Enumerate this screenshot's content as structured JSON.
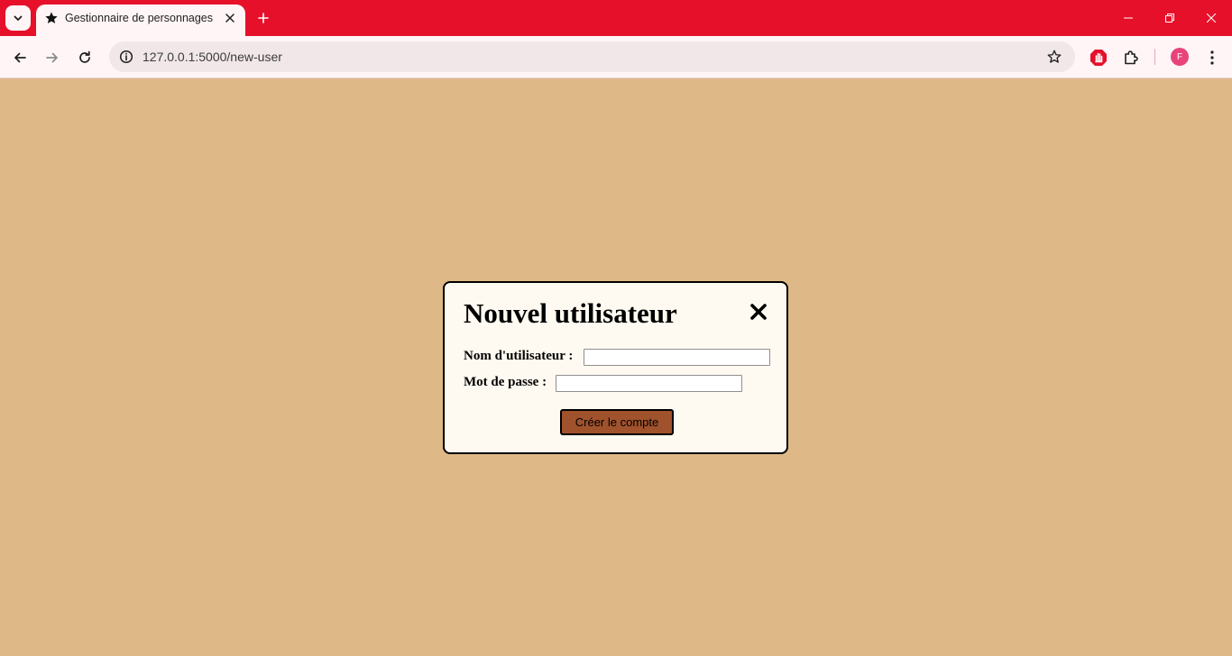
{
  "browser": {
    "tab": {
      "title": "Gestionnaire de personnages",
      "favicon": "star-icon"
    },
    "url": "127.0.0.1:5000/new-user",
    "profile_initial": "F",
    "colors": {
      "frame": "#E6102A",
      "toolbar": "#FFF5F6",
      "avatar": "#E8437A"
    }
  },
  "page": {
    "background": "#DFB887"
  },
  "modal": {
    "title": "Nouvel utilisateur",
    "close_icon": "close-icon",
    "fields": [
      {
        "label": "Nom d'utilisateur :",
        "value": ""
      },
      {
        "label": "Mot de passe :",
        "value": ""
      }
    ],
    "submit_label": "Créer le compte",
    "colors": {
      "background": "#FFFAF1",
      "button": "#A0522D"
    }
  }
}
